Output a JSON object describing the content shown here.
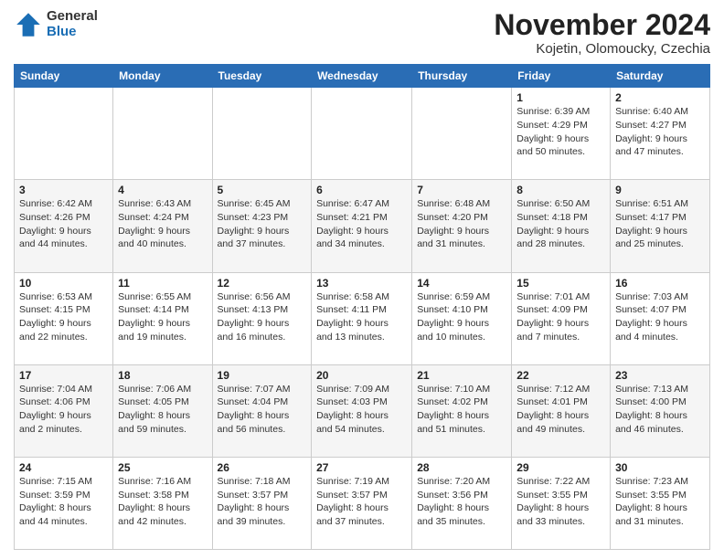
{
  "logo": {
    "general": "General",
    "blue": "Blue"
  },
  "title": "November 2024",
  "subtitle": "Kojetin, Olomoucky, Czechia",
  "days_header": [
    "Sunday",
    "Monday",
    "Tuesday",
    "Wednesday",
    "Thursday",
    "Friday",
    "Saturday"
  ],
  "weeks": [
    [
      {
        "day": "",
        "info": ""
      },
      {
        "day": "",
        "info": ""
      },
      {
        "day": "",
        "info": ""
      },
      {
        "day": "",
        "info": ""
      },
      {
        "day": "",
        "info": ""
      },
      {
        "day": "1",
        "info": "Sunrise: 6:39 AM\nSunset: 4:29 PM\nDaylight: 9 hours\nand 50 minutes."
      },
      {
        "day": "2",
        "info": "Sunrise: 6:40 AM\nSunset: 4:27 PM\nDaylight: 9 hours\nand 47 minutes."
      }
    ],
    [
      {
        "day": "3",
        "info": "Sunrise: 6:42 AM\nSunset: 4:26 PM\nDaylight: 9 hours\nand 44 minutes."
      },
      {
        "day": "4",
        "info": "Sunrise: 6:43 AM\nSunset: 4:24 PM\nDaylight: 9 hours\nand 40 minutes."
      },
      {
        "day": "5",
        "info": "Sunrise: 6:45 AM\nSunset: 4:23 PM\nDaylight: 9 hours\nand 37 minutes."
      },
      {
        "day": "6",
        "info": "Sunrise: 6:47 AM\nSunset: 4:21 PM\nDaylight: 9 hours\nand 34 minutes."
      },
      {
        "day": "7",
        "info": "Sunrise: 6:48 AM\nSunset: 4:20 PM\nDaylight: 9 hours\nand 31 minutes."
      },
      {
        "day": "8",
        "info": "Sunrise: 6:50 AM\nSunset: 4:18 PM\nDaylight: 9 hours\nand 28 minutes."
      },
      {
        "day": "9",
        "info": "Sunrise: 6:51 AM\nSunset: 4:17 PM\nDaylight: 9 hours\nand 25 minutes."
      }
    ],
    [
      {
        "day": "10",
        "info": "Sunrise: 6:53 AM\nSunset: 4:15 PM\nDaylight: 9 hours\nand 22 minutes."
      },
      {
        "day": "11",
        "info": "Sunrise: 6:55 AM\nSunset: 4:14 PM\nDaylight: 9 hours\nand 19 minutes."
      },
      {
        "day": "12",
        "info": "Sunrise: 6:56 AM\nSunset: 4:13 PM\nDaylight: 9 hours\nand 16 minutes."
      },
      {
        "day": "13",
        "info": "Sunrise: 6:58 AM\nSunset: 4:11 PM\nDaylight: 9 hours\nand 13 minutes."
      },
      {
        "day": "14",
        "info": "Sunrise: 6:59 AM\nSunset: 4:10 PM\nDaylight: 9 hours\nand 10 minutes."
      },
      {
        "day": "15",
        "info": "Sunrise: 7:01 AM\nSunset: 4:09 PM\nDaylight: 9 hours\nand 7 minutes."
      },
      {
        "day": "16",
        "info": "Sunrise: 7:03 AM\nSunset: 4:07 PM\nDaylight: 9 hours\nand 4 minutes."
      }
    ],
    [
      {
        "day": "17",
        "info": "Sunrise: 7:04 AM\nSunset: 4:06 PM\nDaylight: 9 hours\nand 2 minutes."
      },
      {
        "day": "18",
        "info": "Sunrise: 7:06 AM\nSunset: 4:05 PM\nDaylight: 8 hours\nand 59 minutes."
      },
      {
        "day": "19",
        "info": "Sunrise: 7:07 AM\nSunset: 4:04 PM\nDaylight: 8 hours\nand 56 minutes."
      },
      {
        "day": "20",
        "info": "Sunrise: 7:09 AM\nSunset: 4:03 PM\nDaylight: 8 hours\nand 54 minutes."
      },
      {
        "day": "21",
        "info": "Sunrise: 7:10 AM\nSunset: 4:02 PM\nDaylight: 8 hours\nand 51 minutes."
      },
      {
        "day": "22",
        "info": "Sunrise: 7:12 AM\nSunset: 4:01 PM\nDaylight: 8 hours\nand 49 minutes."
      },
      {
        "day": "23",
        "info": "Sunrise: 7:13 AM\nSunset: 4:00 PM\nDaylight: 8 hours\nand 46 minutes."
      }
    ],
    [
      {
        "day": "24",
        "info": "Sunrise: 7:15 AM\nSunset: 3:59 PM\nDaylight: 8 hours\nand 44 minutes."
      },
      {
        "day": "25",
        "info": "Sunrise: 7:16 AM\nSunset: 3:58 PM\nDaylight: 8 hours\nand 42 minutes."
      },
      {
        "day": "26",
        "info": "Sunrise: 7:18 AM\nSunset: 3:57 PM\nDaylight: 8 hours\nand 39 minutes."
      },
      {
        "day": "27",
        "info": "Sunrise: 7:19 AM\nSunset: 3:57 PM\nDaylight: 8 hours\nand 37 minutes."
      },
      {
        "day": "28",
        "info": "Sunrise: 7:20 AM\nSunset: 3:56 PM\nDaylight: 8 hours\nand 35 minutes."
      },
      {
        "day": "29",
        "info": "Sunrise: 7:22 AM\nSunset: 3:55 PM\nDaylight: 8 hours\nand 33 minutes."
      },
      {
        "day": "30",
        "info": "Sunrise: 7:23 AM\nSunset: 3:55 PM\nDaylight: 8 hours\nand 31 minutes."
      }
    ]
  ]
}
